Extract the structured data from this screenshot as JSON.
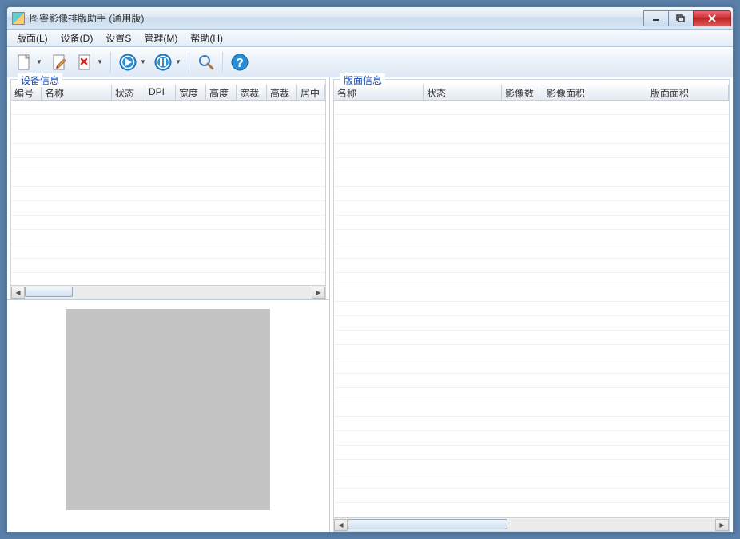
{
  "window": {
    "title": "图睿影像排版助手 (通用版)"
  },
  "menu": {
    "layout": "版面(L)",
    "device": "设备(D)",
    "settings": "设置S",
    "manage": "管理(M)",
    "help": "帮助(H)"
  },
  "left": {
    "legend": "设备信息",
    "cols": {
      "id": "编号",
      "name": "名称",
      "state": "状态",
      "dpi": "DPI",
      "width": "宽度",
      "height": "高度",
      "cropw": "宽裁",
      "croph": "高裁",
      "center": "居中"
    }
  },
  "right": {
    "legend": "版面信息",
    "cols": {
      "name": "名称",
      "state": "状态",
      "imgcount": "影像数",
      "imgarea": "影像面积",
      "pagearea": "版面面积"
    }
  }
}
